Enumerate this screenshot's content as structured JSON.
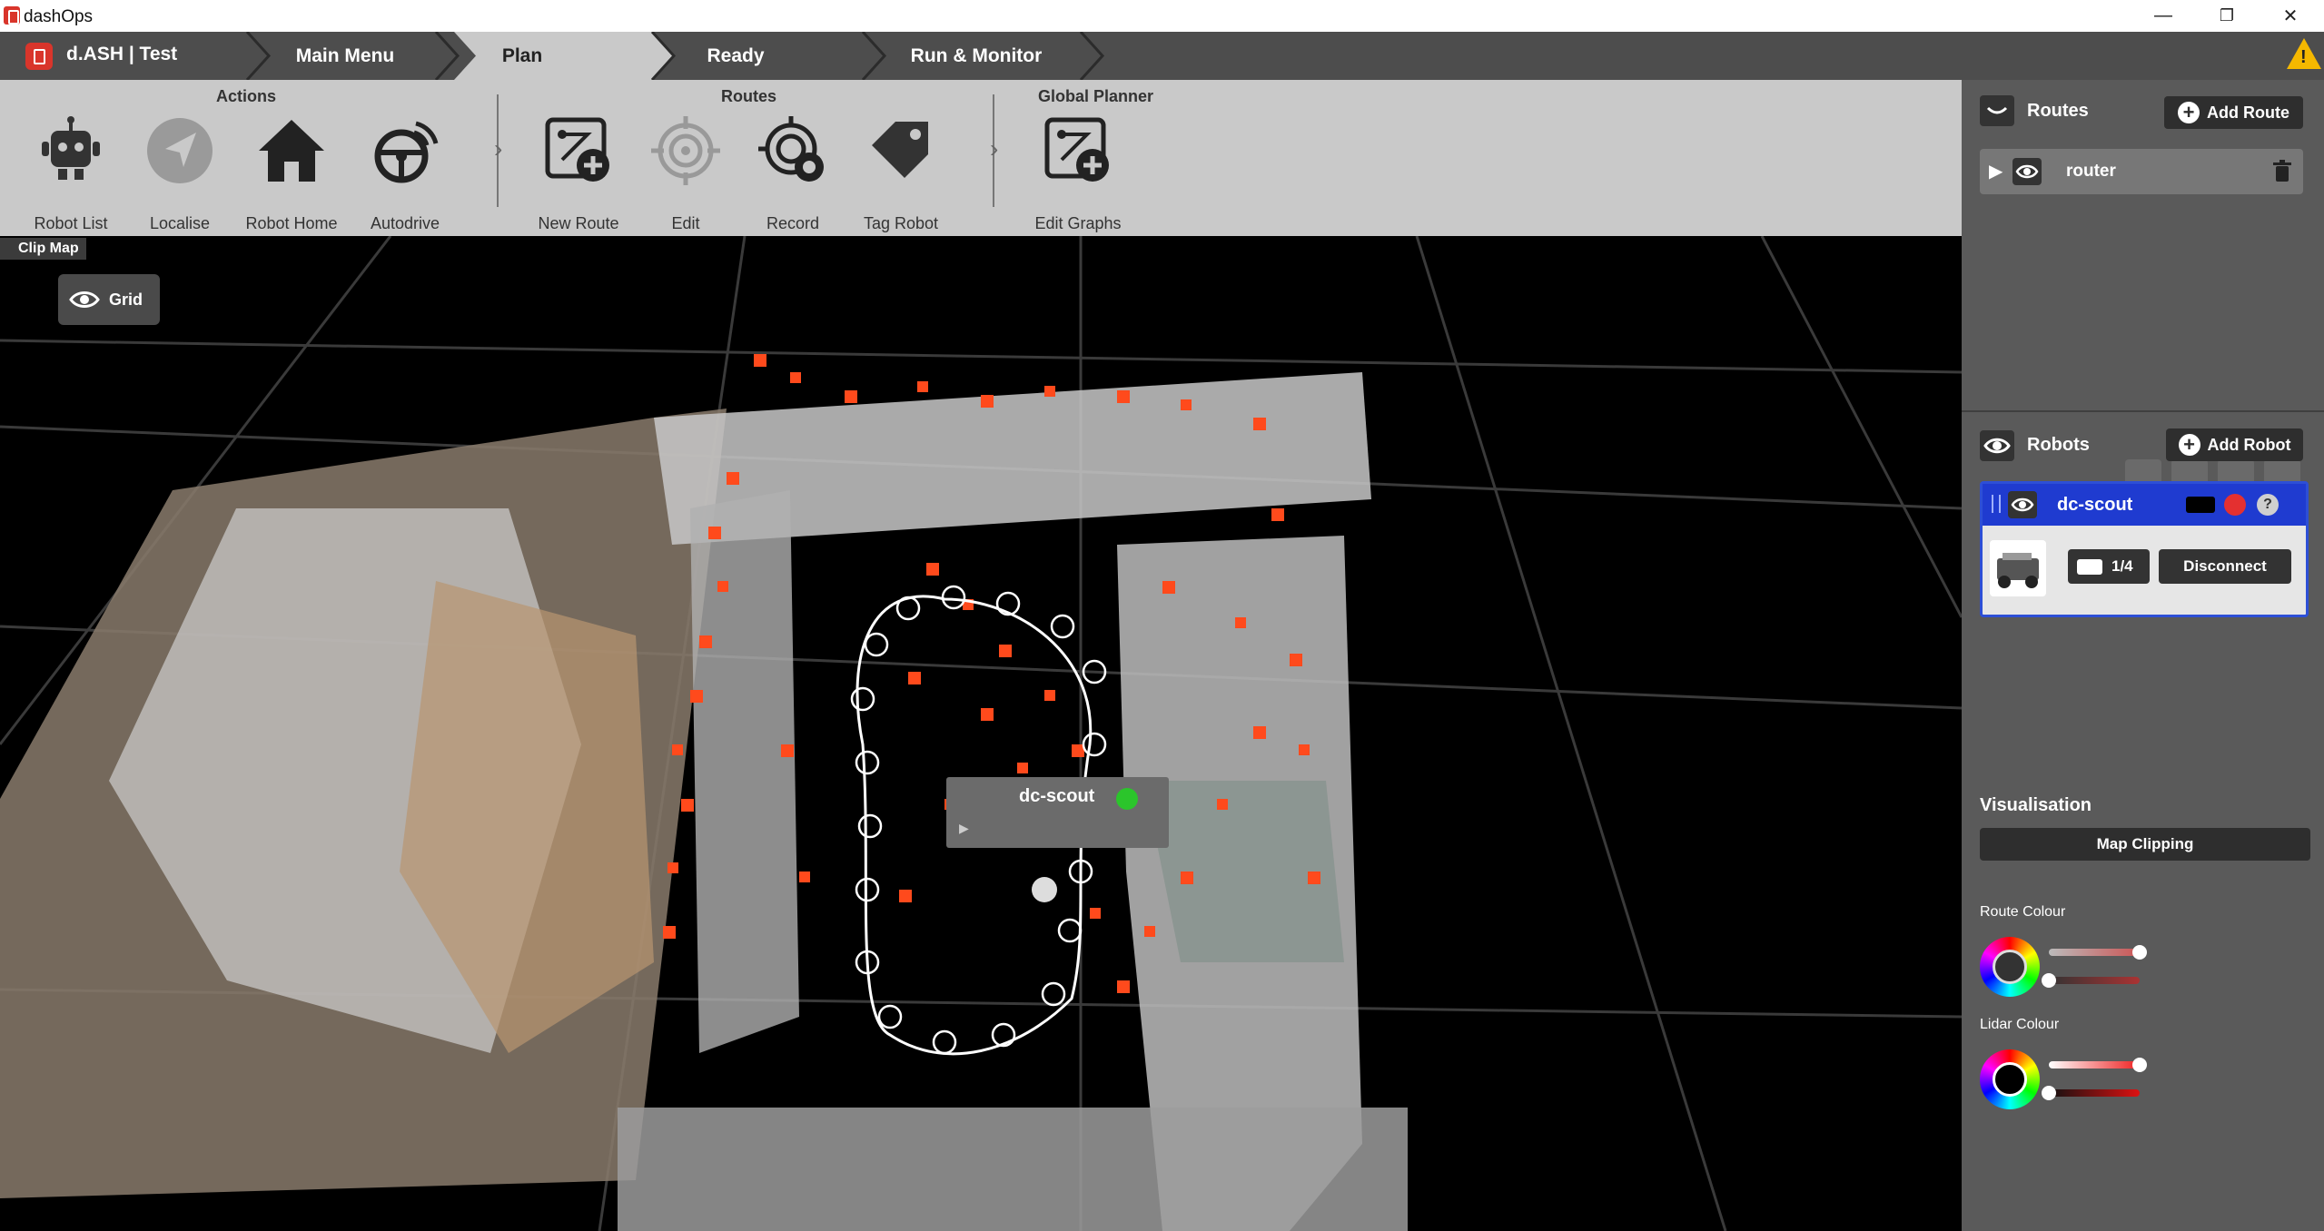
{
  "window": {
    "title": "dashOps",
    "minimize": "—",
    "maximize": "❐",
    "close": "✕"
  },
  "nav": {
    "brand": "d.ASH | Test",
    "crumbs": [
      "Main Menu",
      "Plan",
      "Ready",
      "Run & Monitor"
    ],
    "active": "Plan"
  },
  "toolbar": {
    "actions_title": "Actions",
    "routes_title": "Routes",
    "planner_title": "Global Planner",
    "tools": {
      "robot_list": "Robot List",
      "localise": "Localise",
      "robot_home": "Robot Home",
      "autodrive": "Autodrive",
      "new_route": "New Route",
      "edit": "Edit",
      "record": "Record",
      "tag_robot": "Tag Robot",
      "edit_graphs": "Edit Graphs"
    }
  },
  "viewport": {
    "clip_map": "Clip Map",
    "grid_toggle": "Grid",
    "robot_label": "dc-scout"
  },
  "routes_panel": {
    "title": "Routes",
    "add_button": "Add Route",
    "items": [
      {
        "name": "router"
      }
    ]
  },
  "robots_panel": {
    "title": "Robots",
    "add_button": "Add Robot",
    "robot": {
      "name": "dc-scout",
      "camera_count": "1/4",
      "disconnect": "Disconnect"
    }
  },
  "visualisation": {
    "title": "Visualisation",
    "map_clipping": "Map Clipping",
    "route_colour": "Route Colour",
    "lidar_colour": "Lidar Colour"
  },
  "colors": {
    "accent_blue": "#1f3bd0",
    "lidar_red": "#ff4a1c",
    "warning": "#f5b800",
    "brand_red": "#d9352b"
  }
}
